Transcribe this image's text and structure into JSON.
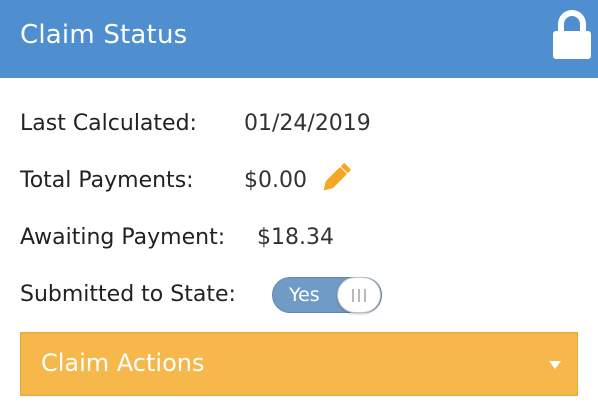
{
  "header": {
    "title": "Claim Status",
    "lock_icon": "lock-icon"
  },
  "fields": {
    "last_calculated": {
      "label": "Last Calculated:",
      "value": "01/24/2019"
    },
    "total_payments": {
      "label": "Total Payments:",
      "value": "$0.00",
      "edit_icon": "pencil-icon"
    },
    "awaiting_payment": {
      "label": "Awaiting Payment:",
      "value": "$18.34"
    },
    "submitted_to_state": {
      "label": "Submitted to State:",
      "toggle_label": "Yes",
      "toggle_on": true
    }
  },
  "actions": {
    "label": "Claim Actions",
    "icon": "caret-down-icon"
  },
  "colors": {
    "header_bg": "#4f8fd0",
    "actions_bg": "#f7b84b",
    "pencil": "#f5a623",
    "toggle_on": "#6f9bc4"
  }
}
